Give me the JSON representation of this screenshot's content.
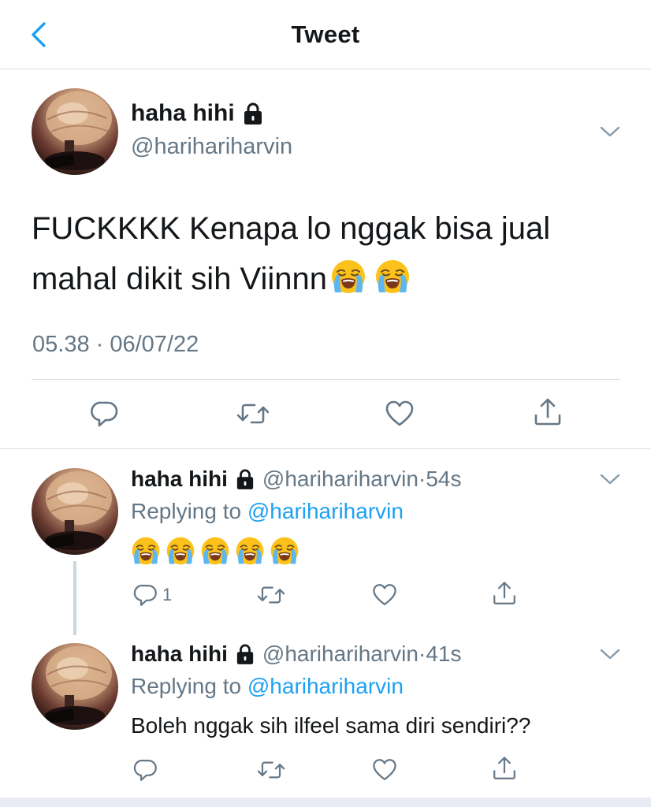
{
  "header": {
    "title": "Tweet",
    "back_icon": "chevron-left-icon",
    "accent": "#1da1f2"
  },
  "main_tweet": {
    "name": "haha hihi",
    "handle": "@harihariharvin",
    "text": "FUCKKKK Kenapa lo nggak bisa jual mahal dikit sih Viinnn",
    "emojis": [
      "loudly-crying-face",
      "loudly-crying-face"
    ],
    "timestamp": "05.38 · 06/07/22",
    "actions": [
      "reply-icon",
      "retweet-icon",
      "like-icon",
      "share-icon"
    ]
  },
  "replies": [
    {
      "name": "haha hihi",
      "handle": "@harihariharvin",
      "dot": "·",
      "time": "54s",
      "replying_label": "Replying to",
      "replying_to": "@harihariharvin",
      "text": "",
      "emojis": [
        "loudly-crying-face",
        "loudly-crying-face",
        "loudly-crying-face",
        "loudly-crying-face",
        "loudly-crying-face"
      ],
      "reply_count": "1"
    },
    {
      "name": "haha hihi",
      "handle": "@harihariharvin",
      "dot": "·",
      "time": "41s",
      "replying_label": "Replying to",
      "replying_to": "@harihariharvin",
      "text": "Boleh nggak sih ilfeel sama diri sendiri??",
      "emojis": [],
      "reply_count": ""
    }
  ]
}
